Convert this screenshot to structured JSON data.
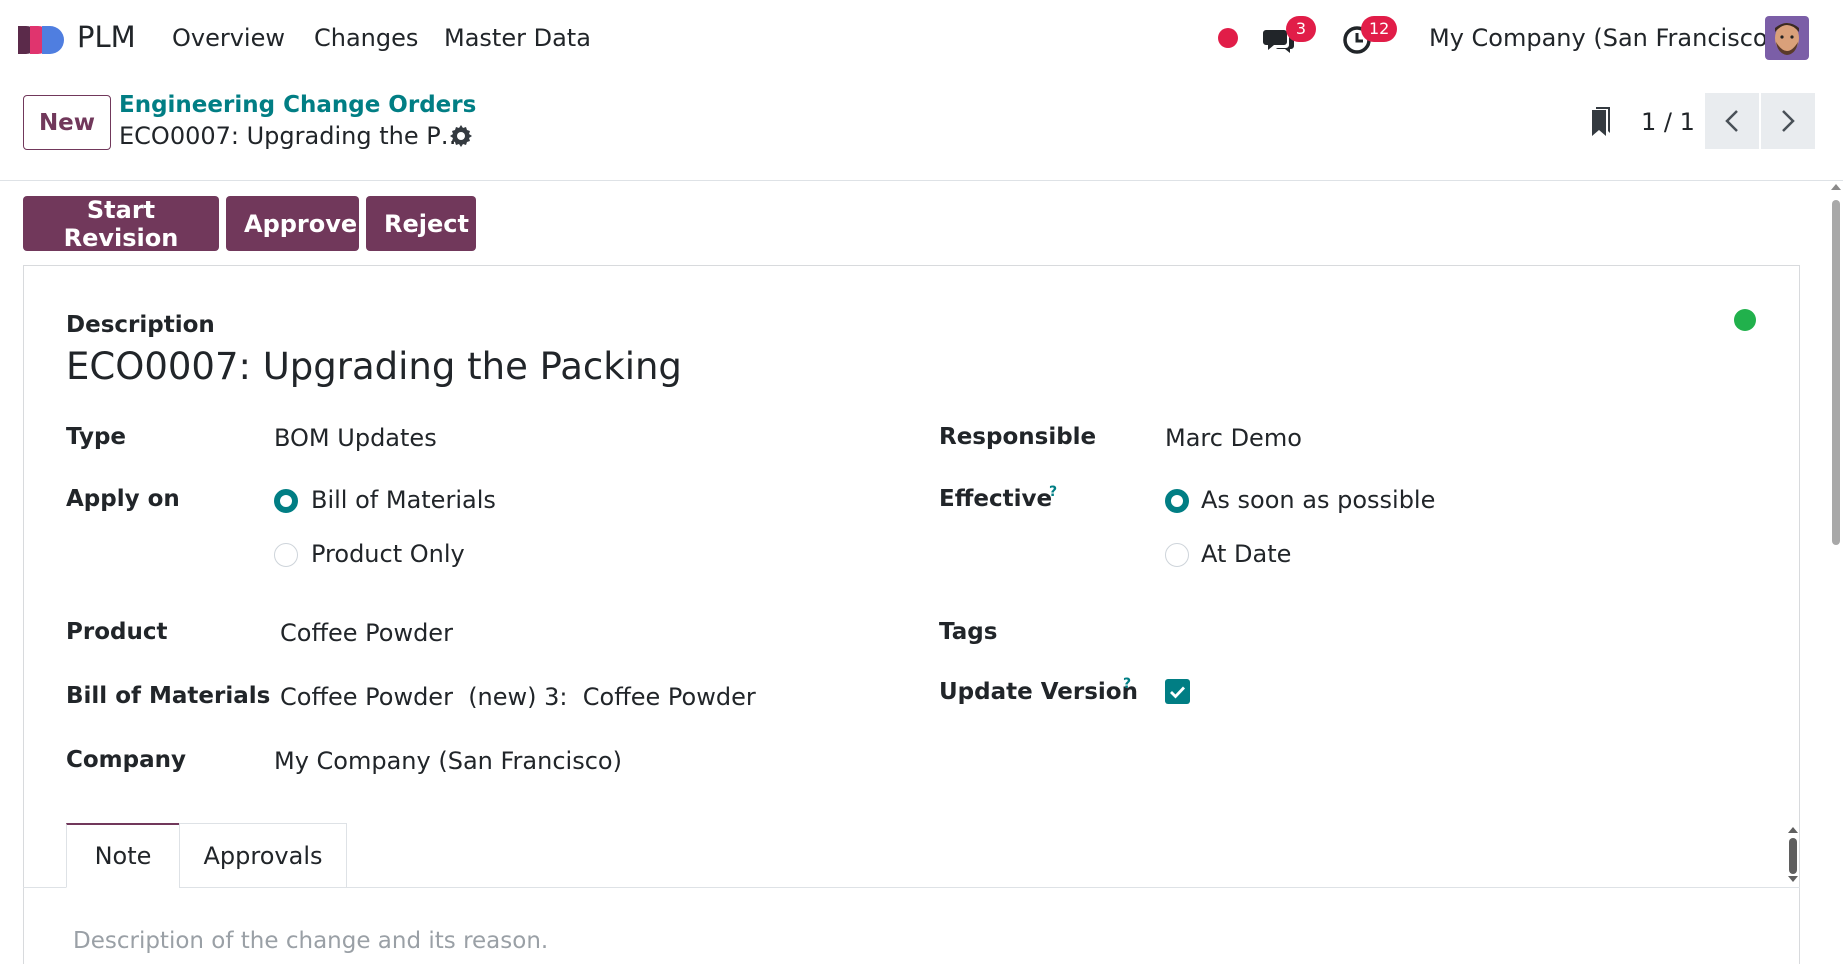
{
  "navbar": {
    "app_name": "PLM",
    "menu": [
      "Overview",
      "Changes",
      "Master Data"
    ],
    "messages_count": "3",
    "activities_count": "12",
    "company": "My Company (San Francisco)",
    "brand_color": "#71385b",
    "alert_color": "#e11d48"
  },
  "control_panel": {
    "new_label": "New",
    "breadcrumb_parent": "Engineering Change Orders",
    "breadcrumb_current": "ECO0007: Upgrading the P…",
    "pager": "1 / 1"
  },
  "actions": {
    "start_revision": "Start Revision",
    "approve": "Approve",
    "reject": "Reject"
  },
  "form": {
    "description_label": "Description",
    "title": "ECO0007: Upgrading the Packing",
    "status_color": "#21b14c",
    "type_label": "Type",
    "type_value": "BOM Updates",
    "apply_on_label": "Apply on",
    "apply_on_options": [
      "Bill of Materials",
      "Product Only"
    ],
    "apply_on_selected": "Bill of Materials",
    "product_label": "Product",
    "product_value": "Coffee Powder",
    "bom_label": "Bill of Materials",
    "bom_value": "Coffee Powder  (new) 3:  Coffee Powder",
    "company_label": "Company",
    "company_value": "My Company (San Francisco)",
    "responsible_label": "Responsible",
    "responsible_value": "Marc Demo",
    "effective_label": "Effective",
    "effective_options": [
      "As soon as possible",
      "At Date"
    ],
    "effective_selected": "As soon as possible",
    "tags_label": "Tags",
    "update_version_label": "Update Version",
    "update_version_checked": true,
    "help_mark": "?"
  },
  "tabs": [
    "Note",
    "Approvals"
  ],
  "note": {
    "placeholder": "Description of the change and its reason."
  }
}
